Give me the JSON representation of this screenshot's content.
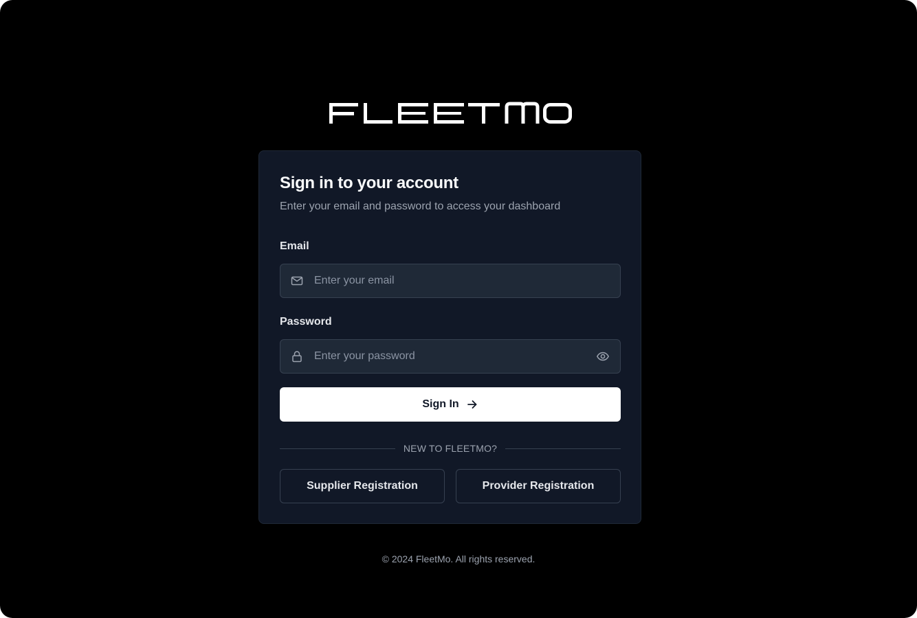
{
  "brand": {
    "logo_text": "FLEETMO"
  },
  "login": {
    "title": "Sign in to your account",
    "subtitle": "Enter your email and password to access your dashboard",
    "email_label": "Email",
    "email_placeholder": "Enter your email",
    "email_icon": "mail-icon",
    "password_label": "Password",
    "password_placeholder": "Enter your password",
    "password_icon": "lock-icon",
    "password_toggle_icon": "eye-icon",
    "submit_label": "Sign In",
    "submit_icon": "arrow-right-icon"
  },
  "registration": {
    "divider_text": "NEW TO FLEETMO?",
    "supplier_label": "Supplier Registration",
    "provider_label": "Provider Registration"
  },
  "footer": {
    "copyright": "© 2024 FleetMo. All rights reserved."
  },
  "colors": {
    "page_background": "#000000",
    "card_background": "#111827",
    "input_background": "#1f2937",
    "border": "#374151",
    "primary_button": "#ffffff",
    "text_primary": "#f9fafb",
    "text_muted": "#9ca3af"
  }
}
